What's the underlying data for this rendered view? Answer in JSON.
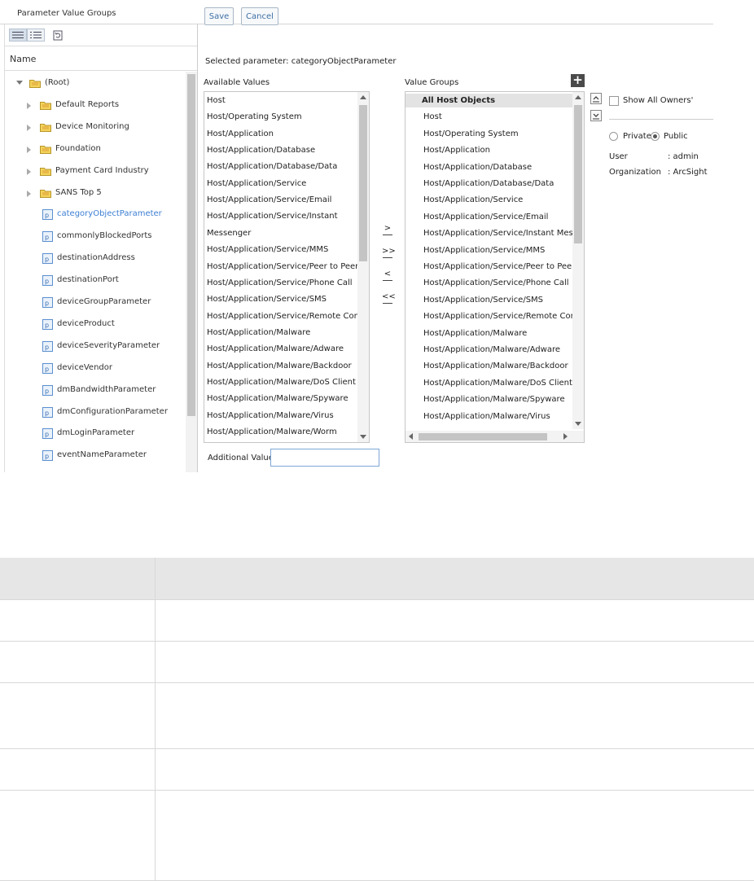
{
  "window": {
    "title": "Parameter Value Groups"
  },
  "left_pane": {
    "column_header": "Name",
    "tree": [
      {
        "label": "(Root)",
        "type": "folder",
        "expanded": true,
        "level": 0
      },
      {
        "label": "Default Reports",
        "type": "folder",
        "expanded": false,
        "level": 1
      },
      {
        "label": "Device Monitoring",
        "type": "folder",
        "expanded": false,
        "level": 1
      },
      {
        "label": "Foundation",
        "type": "folder",
        "expanded": false,
        "level": 1
      },
      {
        "label": "Payment Card Industry",
        "type": "folder",
        "expanded": false,
        "level": 1
      },
      {
        "label": "SANS Top 5",
        "type": "folder",
        "expanded": false,
        "level": 1
      },
      {
        "label": "categoryObjectParameter",
        "type": "parameter",
        "selected": true,
        "level": 2
      },
      {
        "label": "commonlyBlockedPorts",
        "type": "parameter",
        "level": 2
      },
      {
        "label": "destinationAddress",
        "type": "parameter",
        "level": 2
      },
      {
        "label": "destinationPort",
        "type": "parameter",
        "level": 2
      },
      {
        "label": "deviceGroupParameter",
        "type": "parameter",
        "level": 2
      },
      {
        "label": "deviceProduct",
        "type": "parameter",
        "level": 2
      },
      {
        "label": "deviceSeverityParameter",
        "type": "parameter",
        "level": 2
      },
      {
        "label": "deviceVendor",
        "type": "parameter",
        "level": 2
      },
      {
        "label": "dmBandwidthParameter",
        "type": "parameter",
        "level": 2
      },
      {
        "label": "dmConfigurationParameter",
        "type": "parameter",
        "level": 2
      },
      {
        "label": "dmLoginParameter",
        "type": "parameter",
        "level": 2
      },
      {
        "label": "eventNameParameter",
        "type": "parameter",
        "level": 2
      }
    ]
  },
  "toolbar": {
    "save_label": "Save",
    "cancel_label": "Cancel"
  },
  "selected_parameter": "Selected parameter: categoryObjectParameter",
  "available_values": {
    "label": "Available Values",
    "items": [
      "Host",
      "Host/Operating System",
      "Host/Application",
      "Host/Application/Database",
      "Host/Application/Database/Data",
      "Host/Application/Service",
      "Host/Application/Service/Email",
      "Host/Application/Service/Instant",
      "Messenger",
      "Host/Application/Service/MMS",
      "Host/Application/Service/Peer to Peer",
      "Host/Application/Service/Phone Call",
      "Host/Application/Service/SMS",
      "Host/Application/Service/Remote Control",
      "Host/Application/Malware",
      "Host/Application/Malware/Adware",
      "Host/Application/Malware/Backdoor",
      "Host/Application/Malware/DoS Client",
      "Host/Application/Malware/Spyware",
      "Host/Application/Malware/Virus",
      "Host/Application/Malware/Worm"
    ]
  },
  "move_buttons": {
    "add_one": ">",
    "add_all": ">>",
    "remove_one": "<",
    "remove_all": "<<"
  },
  "value_groups": {
    "label": "Value Groups",
    "items": [
      "All Host Objects",
      "Host",
      "Host/Operating System",
      "Host/Application",
      "Host/Application/Database",
      "Host/Application/Database/Data",
      "Host/Application/Service",
      "Host/Application/Service/Email",
      "Host/Application/Service/Instant Messeng",
      "Host/Application/Service/MMS",
      "Host/Application/Service/Peer to Peer",
      "Host/Application/Service/Phone Call",
      "Host/Application/Service/SMS",
      "Host/Application/Service/Remote Contro",
      "Host/Application/Malware",
      "Host/Application/Malware/Adware",
      "Host/Application/Malware/Backdoor",
      "Host/Application/Malware/DoS Client",
      "Host/Application/Malware/Spyware",
      "Host/Application/Malware/Virus"
    ]
  },
  "additional_value": {
    "label": "Additional Value",
    "value": ""
  },
  "owners": {
    "show_all_label": "Show All Owners'",
    "show_all_checked": false,
    "private_label": "Private",
    "public_label": "Public",
    "selected": "Public",
    "user_label": "User",
    "user_value": ": admin",
    "org_label": "Organization",
    "org_value": ": ArcSight"
  }
}
